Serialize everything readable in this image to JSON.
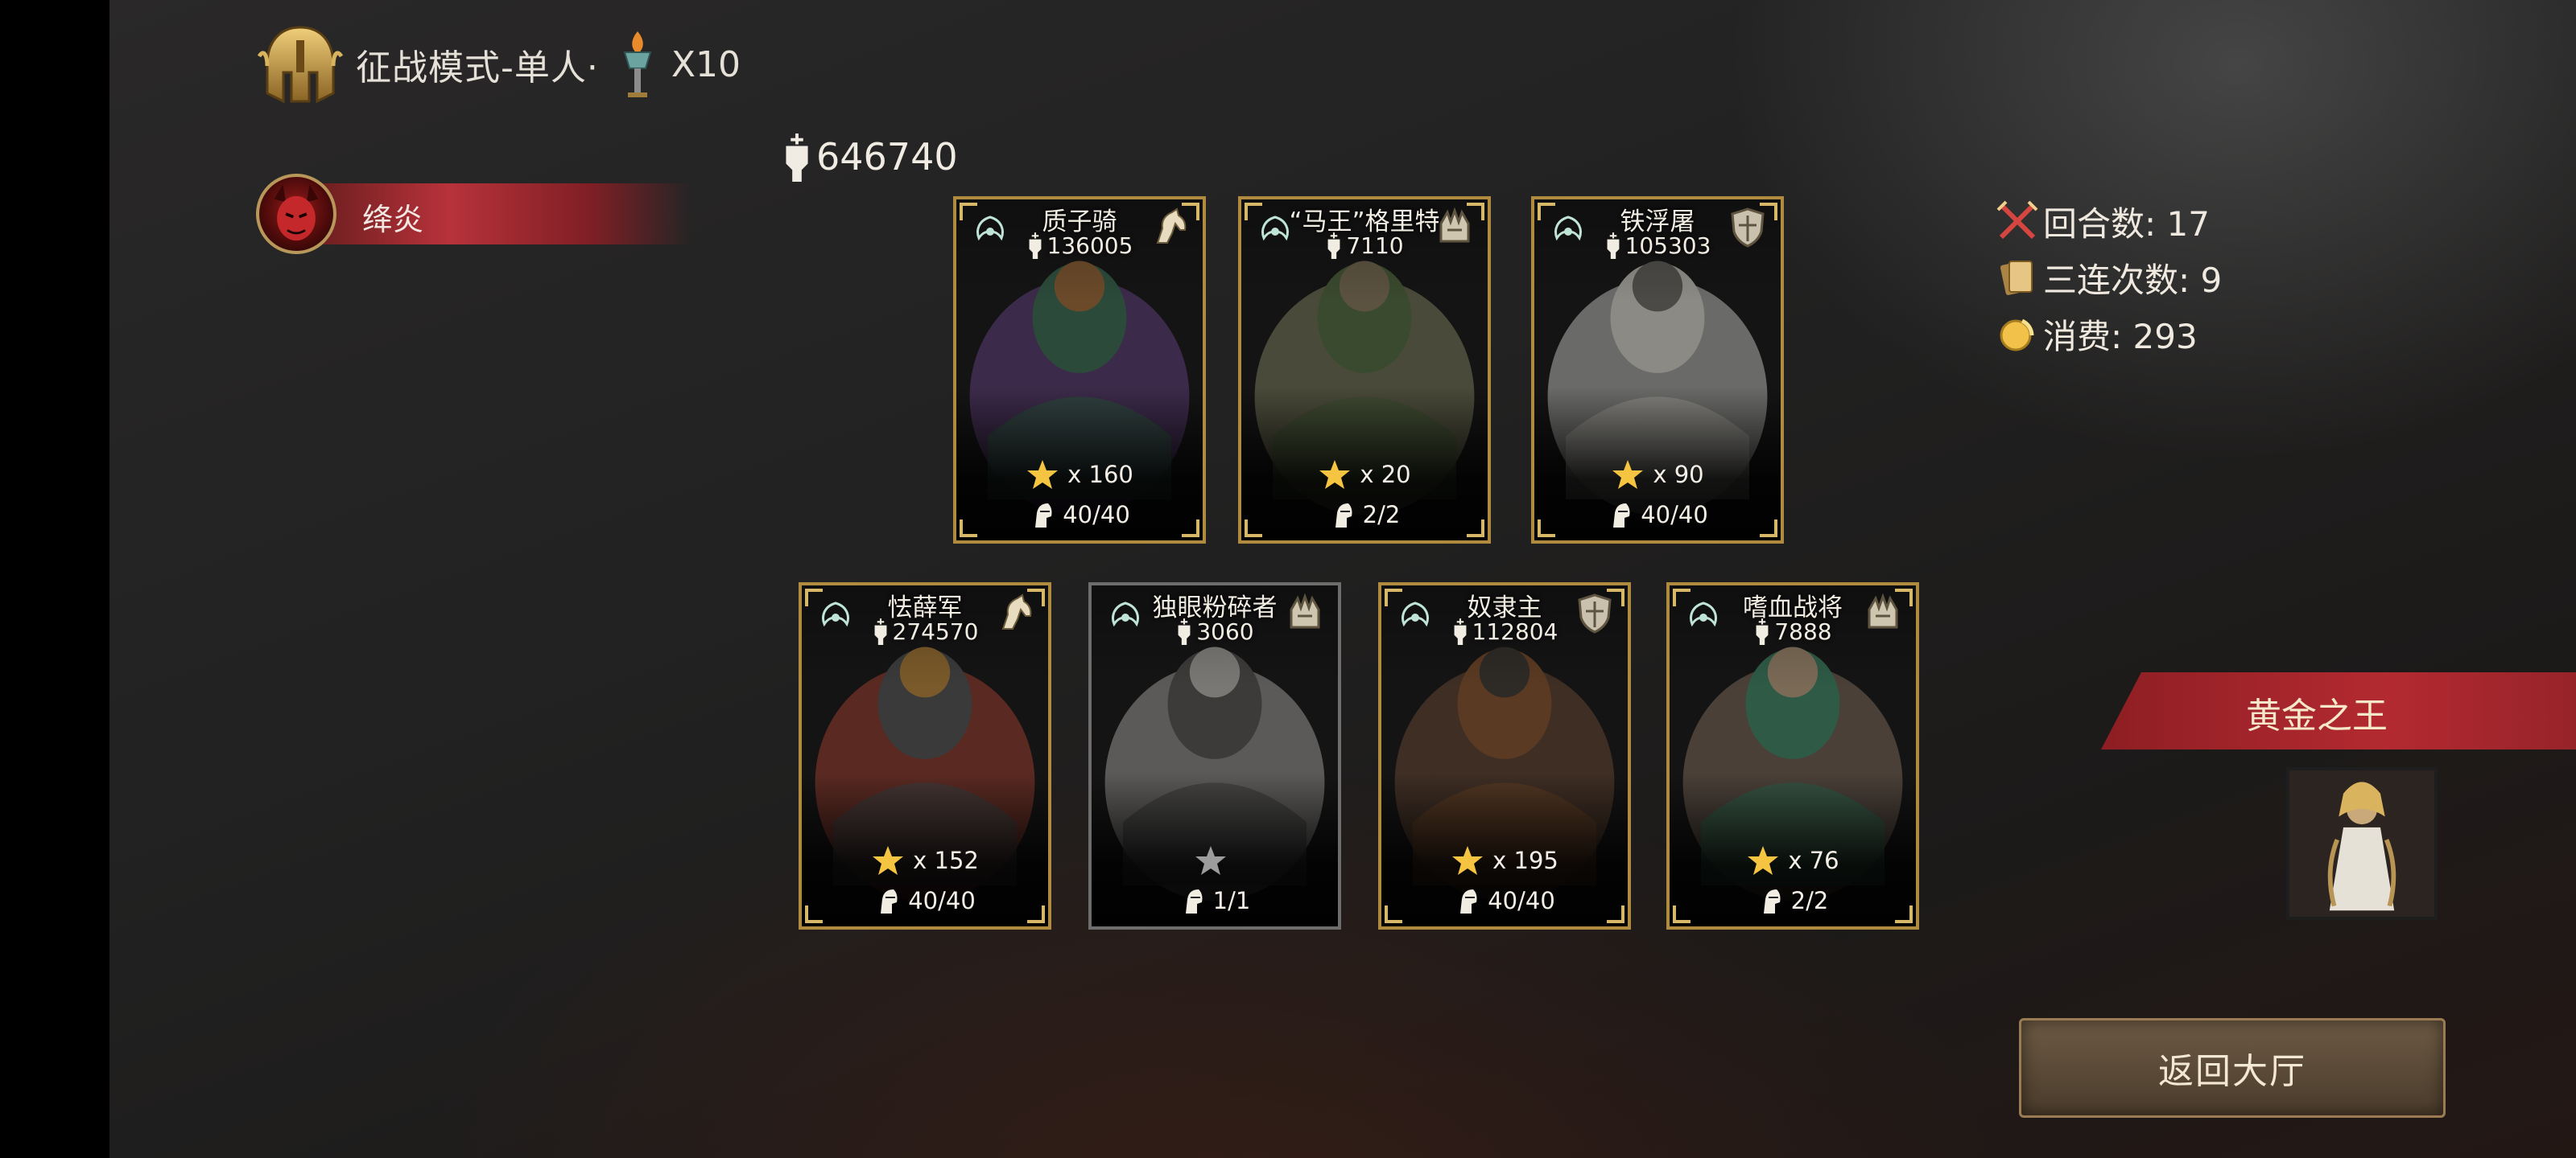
{
  "header": {
    "mode_title": "征战模式-单人·",
    "torch_count": "X10",
    "icons": [
      "helmet-icon",
      "torch-icon"
    ]
  },
  "player": {
    "name": "绛炎"
  },
  "total_power": "646740",
  "cards_row1": [
    {
      "name": "质子骑",
      "power": "136005",
      "stars": "x 160",
      "troops": "40/40",
      "type_icon": "horse-icon",
      "frame": "gold"
    },
    {
      "name": "“马王”格里特",
      "power": "7110",
      "stars": "x 20",
      "troops": "2/2",
      "type_icon": "helmet-crest-icon",
      "frame": "gold"
    },
    {
      "name": "铁浮屠",
      "power": "105303",
      "stars": "x 90",
      "troops": "40/40",
      "type_icon": "shield-icon",
      "frame": "gold"
    }
  ],
  "cards_row2": [
    {
      "name": "怯薛军",
      "power": "274570",
      "stars": "x 152",
      "troops": "40/40",
      "type_icon": "horse-icon",
      "frame": "gold"
    },
    {
      "name": "独眼粉碎者",
      "power": "3060",
      "stars": "",
      "troops": "1/1",
      "type_icon": "helmet-crest-icon",
      "frame": "gray"
    },
    {
      "name": "奴隶主",
      "power": "112804",
      "stars": "x 195",
      "troops": "40/40",
      "type_icon": "shield-icon",
      "frame": "gold"
    },
    {
      "name": "嗜血战将",
      "power": "7888",
      "stars": "x 76",
      "troops": "2/2",
      "type_icon": "helmet-crest-icon",
      "frame": "gold"
    }
  ],
  "stats": {
    "rounds": "回合数: 17",
    "triple": "三连次数: 9",
    "cost": "消费: 293"
  },
  "opponent": {
    "name": "黄金之王"
  },
  "return_button": "返回大厅",
  "colors": {
    "gold_frame": "#b08a3e",
    "red_banner": "#b32a30",
    "star": "#f5c542",
    "button": "#5a4836"
  }
}
